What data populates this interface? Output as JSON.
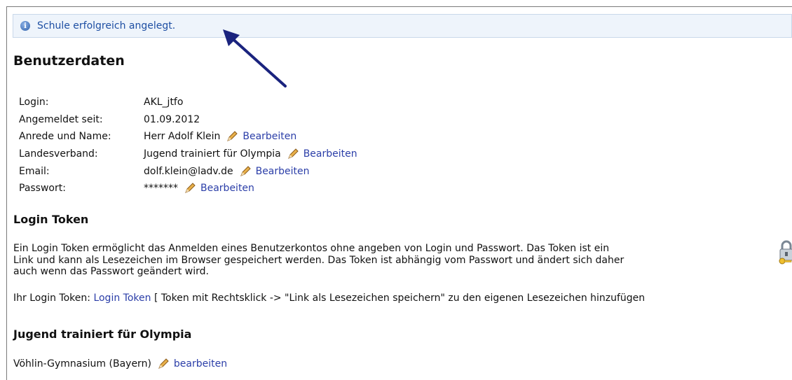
{
  "notice": {
    "text": "Schule erfolgreich angelegt."
  },
  "benutzerdaten": {
    "heading": "Benutzerdaten",
    "rows": [
      {
        "label": "Login:",
        "value": "AKL_jtfo"
      },
      {
        "label": "Angemeldet seit:",
        "value": "01.09.2012"
      },
      {
        "label": "Anrede und Name:",
        "value": "Herr Adolf Klein",
        "edit": "Bearbeiten"
      },
      {
        "label": "Landesverband:",
        "value": "Jugend trainiert für Olympia",
        "edit": "Bearbeiten"
      },
      {
        "label": "Email:",
        "value": "dolf.klein@ladv.de",
        "edit": "Bearbeiten"
      },
      {
        "label": "Passwort:",
        "value": "*******",
        "edit": "Bearbeiten"
      }
    ]
  },
  "login_token": {
    "heading": "Login Token",
    "description_line1": "Ein Login Token ermöglicht das Anmelden eines Benutzerkontos ohne angeben von Login und Passwort. Das Token ist ein",
    "description_line2": "Link und kann als Lesezeichen im Browser gespeichert werden. Das Token ist abhängig vom Passwort und ändert sich daher",
    "description_line3": "auch wenn das Passwort geändert wird.",
    "your_token_label": "Ihr Login Token:",
    "token_link": "Login Token",
    "token_hint": "[ Token mit Rechtsklick -> \"Link als Lesezeichen speichern\" zu den eigenen Lesezeichen hinzufügen"
  },
  "jtfo": {
    "heading": "Jugend trainiert für Olympia",
    "school": "Vöhlin-Gymnasium (Bayern)",
    "edit": "bearbeiten"
  },
  "icons": {
    "info": "info-icon",
    "pencil": "pencil-icon",
    "lock": "lock-key-icon",
    "arrow": "annotation-arrow"
  },
  "colors": {
    "link": "#2b3ea8",
    "notice_bg": "#eef4fb",
    "notice_text": "#1e4fa3",
    "arrow": "#1a237e"
  }
}
